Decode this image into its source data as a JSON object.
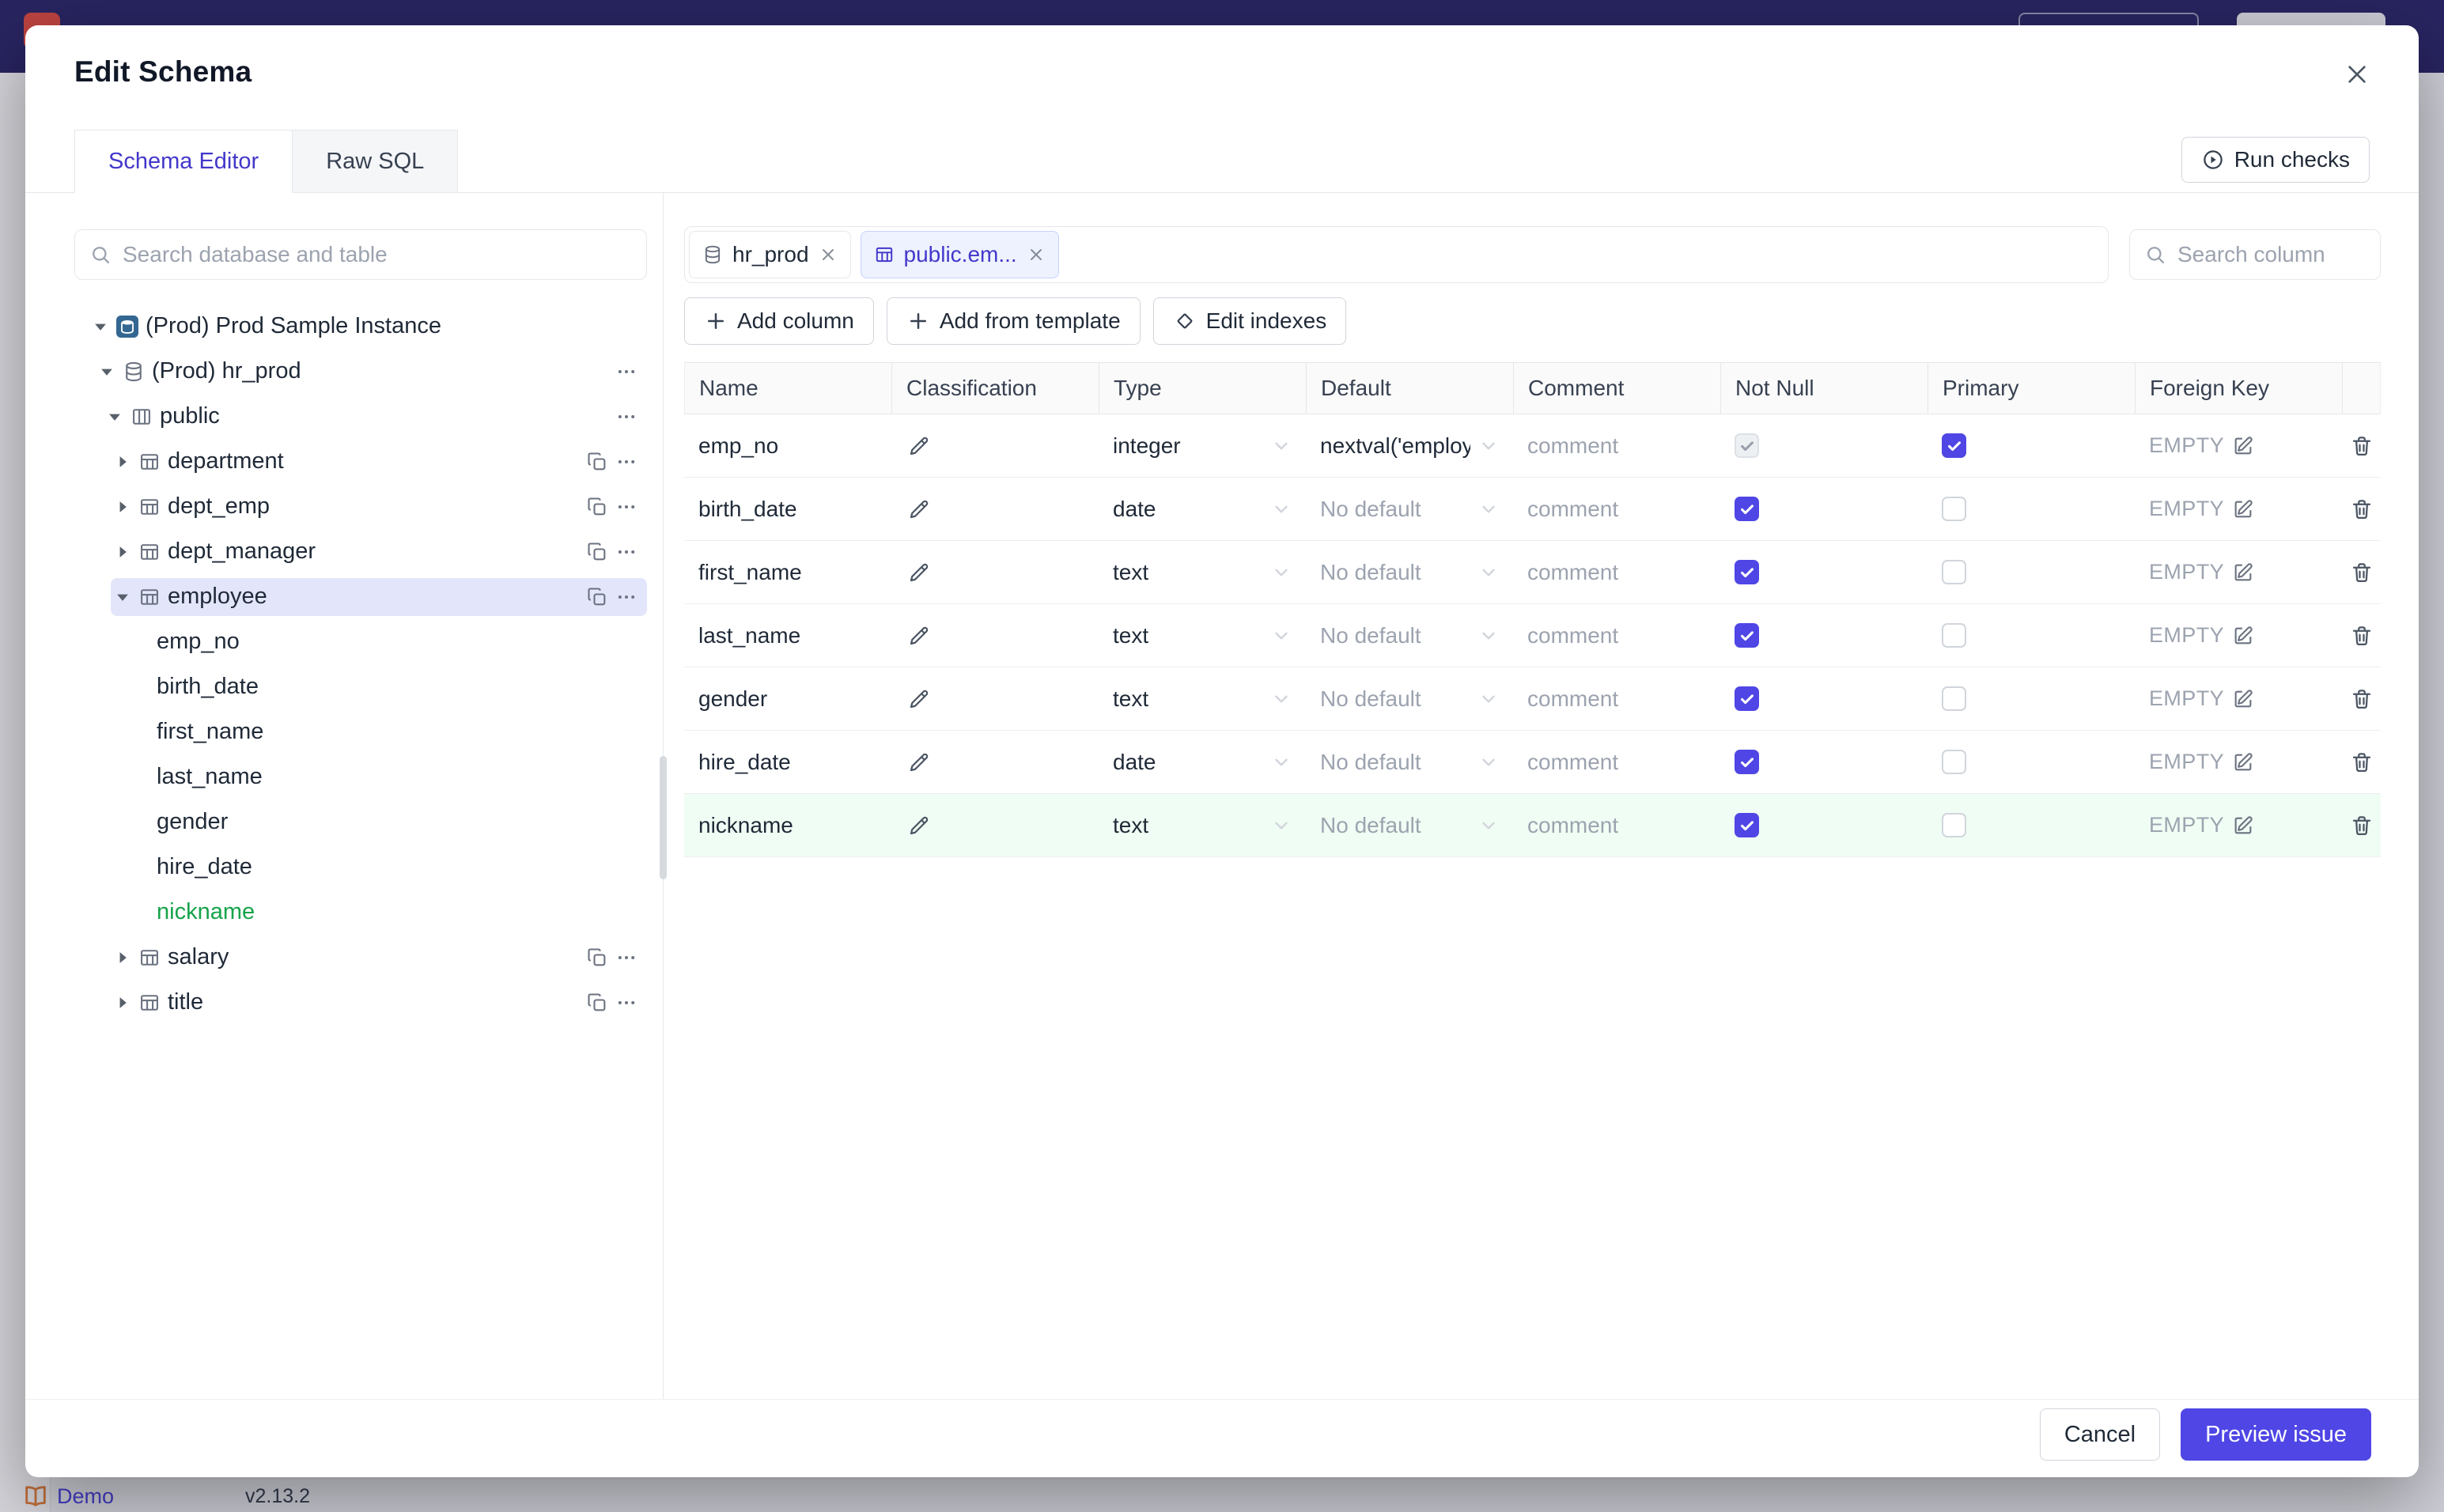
{
  "background": {
    "brand": "Demo",
    "version": "v2.13.2"
  },
  "modal": {
    "title": "Edit Schema",
    "run_checks": "Run checks",
    "tabs": [
      {
        "id": "schema-editor",
        "label": "Schema Editor",
        "active": true
      },
      {
        "id": "raw-sql",
        "label": "Raw SQL",
        "active": false
      }
    ],
    "sidebar": {
      "search_placeholder": "Search database and table",
      "tree": [
        {
          "label": "(Prod) Prod Sample Instance",
          "kind": "instance",
          "arrow": "down",
          "indent": 0
        },
        {
          "label": "(Prod) hr_prod",
          "kind": "database",
          "arrow": "down",
          "indent": 1,
          "more": true
        },
        {
          "label": "public",
          "kind": "schema",
          "arrow": "down",
          "indent": 2,
          "more": true
        },
        {
          "label": "department",
          "kind": "table",
          "arrow": "right",
          "indent": 3,
          "copy": true,
          "more": true
        },
        {
          "label": "dept_emp",
          "kind": "table",
          "arrow": "right",
          "indent": 3,
          "copy": true,
          "more": true
        },
        {
          "label": "dept_manager",
          "kind": "table",
          "arrow": "right",
          "indent": 3,
          "copy": true,
          "more": true
        },
        {
          "label": "employee",
          "kind": "table",
          "arrow": "down",
          "indent": 3,
          "copy": true,
          "more": true,
          "selected": true
        },
        {
          "label": "emp_no",
          "kind": "column",
          "indent": 4
        },
        {
          "label": "birth_date",
          "kind": "column",
          "indent": 4
        },
        {
          "label": "first_name",
          "kind": "column",
          "indent": 4
        },
        {
          "label": "last_name",
          "kind": "column",
          "indent": 4
        },
        {
          "label": "gender",
          "kind": "column",
          "indent": 4
        },
        {
          "label": "hire_date",
          "kind": "column",
          "indent": 4
        },
        {
          "label": "nickname",
          "kind": "column",
          "indent": 4,
          "green": true
        },
        {
          "label": "salary",
          "kind": "table",
          "arrow": "right",
          "indent": 3,
          "copy": true,
          "more": true
        },
        {
          "label": "title",
          "kind": "table",
          "arrow": "right",
          "indent": 3,
          "copy": true,
          "more": true
        }
      ]
    },
    "editor": {
      "tabs": [
        {
          "label": "hr_prod",
          "icon": "database",
          "active": false
        },
        {
          "label": "public.em...",
          "icon": "table",
          "active": true
        }
      ],
      "search_placeholder": "Search column",
      "actions": [
        {
          "id": "add-column",
          "label": "Add column",
          "icon": "plus"
        },
        {
          "id": "add-from-template",
          "label": "Add from template",
          "icon": "plus"
        },
        {
          "id": "edit-indexes",
          "label": "Edit indexes",
          "icon": "diamond"
        }
      ],
      "table": {
        "headers": [
          "Name",
          "Classification",
          "Type",
          "Default",
          "Comment",
          "Not Null",
          "Primary",
          "Foreign Key"
        ],
        "comment_placeholder": "comment",
        "foreign_key_empty": "EMPTY",
        "rows": [
          {
            "name": "emp_no",
            "type": "integer",
            "default": "nextval('employ",
            "default_is_placeholder": false,
            "not_null": "disabled-checked",
            "primary": "checked",
            "highlight": false
          },
          {
            "name": "birth_date",
            "type": "date",
            "default": "No default",
            "default_is_placeholder": true,
            "not_null": "checked",
            "primary": "unchecked",
            "highlight": false
          },
          {
            "name": "first_name",
            "type": "text",
            "default": "No default",
            "default_is_placeholder": true,
            "not_null": "checked",
            "primary": "unchecked",
            "highlight": false
          },
          {
            "name": "last_name",
            "type": "text",
            "default": "No default",
            "default_is_placeholder": true,
            "not_null": "checked",
            "primary": "unchecked",
            "highlight": false
          },
          {
            "name": "gender",
            "type": "text",
            "default": "No default",
            "default_is_placeholder": true,
            "not_null": "checked",
            "primary": "unchecked",
            "highlight": false
          },
          {
            "name": "hire_date",
            "type": "date",
            "default": "No default",
            "default_is_placeholder": true,
            "not_null": "checked",
            "primary": "unchecked",
            "highlight": false
          },
          {
            "name": "nickname",
            "type": "text",
            "default": "No default",
            "default_is_placeholder": true,
            "not_null": "checked",
            "primary": "unchecked",
            "highlight": true
          }
        ]
      }
    },
    "footer": {
      "cancel": "Cancel",
      "primary": "Preview issue"
    }
  },
  "colors": {
    "accent": "#4f46e5",
    "new_item_green": "#16a34a",
    "new_row_bg": "#f0fdf4",
    "topbar": "#2c2869"
  }
}
